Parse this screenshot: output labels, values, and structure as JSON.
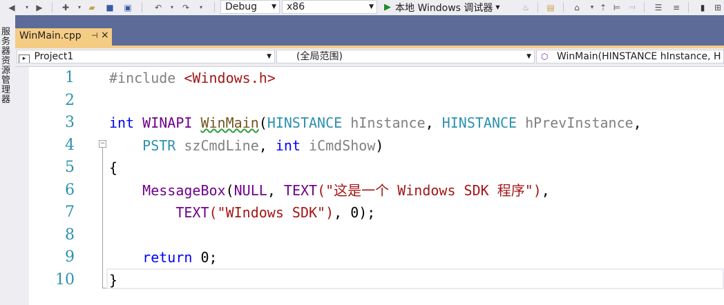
{
  "toolbar": {
    "config": "Debug",
    "platform": "x86",
    "run_label": "本地 Windows 调试器"
  },
  "left_strip": {
    "label": "服务器资源管理器"
  },
  "tab": {
    "name": "WinMain.cpp",
    "pin": "⊣",
    "close": "×"
  },
  "navbar": {
    "project": "Project1",
    "scope": "(全局范围)",
    "member": "WinMain(HINSTANCE hInstance, H"
  },
  "editor": {
    "line_numbers": [
      "1",
      "2",
      "3",
      "4",
      "5",
      "6",
      "7",
      "8",
      "9",
      "10"
    ],
    "code": {
      "l1_include": "#include",
      "l1_header": "<Windows.h>",
      "l3_int": "int",
      "l3_winapi": "WINAPI",
      "l3_winmain": "WinMain",
      "l3_paren": "(",
      "l3_hinst_type": "HINSTANCE",
      "l3_hinst": "hInstance",
      "l3_comma1": ",",
      "l3_hprev_type": "HINSTANCE",
      "l3_hprev": "hPrevInstance",
      "l3_comma2": ",",
      "l4_pstr": "PSTR",
      "l4_cmdline": "szCmdLine",
      "l4_comma": ",",
      "l4_int": "int",
      "l4_cmdshow": "iCmdShow",
      "l4_close": ")",
      "l5_brace": "{",
      "l6_msgbox": "MessageBox",
      "l6_open": "(",
      "l6_null": "NULL",
      "l6_comma": ",",
      "l6_text": "TEXT",
      "l6_str": "(\"这是一个 Windows SDK 程序\")",
      "l6_end": ",",
      "l7_text": "TEXT",
      "l7_str": "(\"WIndows SDK\")",
      "l7_end": ", 0);",
      "l9_return": "return",
      "l9_val": "0;",
      "l10_brace": "}"
    }
  }
}
